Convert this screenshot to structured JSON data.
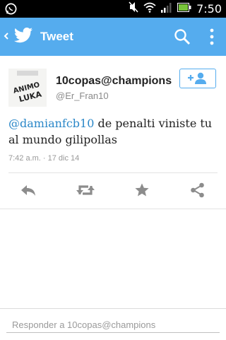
{
  "status_bar": {
    "time": "7:50",
    "icons": [
      "whatsapp-icon",
      "mute-icon",
      "wifi-icon",
      "signal-icon",
      "battery-icon"
    ]
  },
  "action_bar": {
    "title": "Tweet",
    "color": "#55acee",
    "icons": [
      "back-icon",
      "twitter-bird-icon",
      "search-icon",
      "overflow-menu-icon"
    ]
  },
  "tweet": {
    "author_name": "10copas@champions",
    "author_handle": "@Er_Fran10",
    "avatar_text_line1": "ANIMO",
    "avatar_text_line2": "LUKA",
    "mention": "@damianfcb10",
    "body": " de penalti viniste tu al mundo gilipollas",
    "timestamp": "7:42 a.m. · 17 dic 14",
    "mention_color": "#2a87c8"
  },
  "actions": [
    "reply-icon",
    "retweet-icon",
    "favorite-icon",
    "share-icon"
  ],
  "follow_button": {
    "icon": "follow-user-icon"
  },
  "reply": {
    "placeholder": "Responder a 10copas@champions"
  }
}
